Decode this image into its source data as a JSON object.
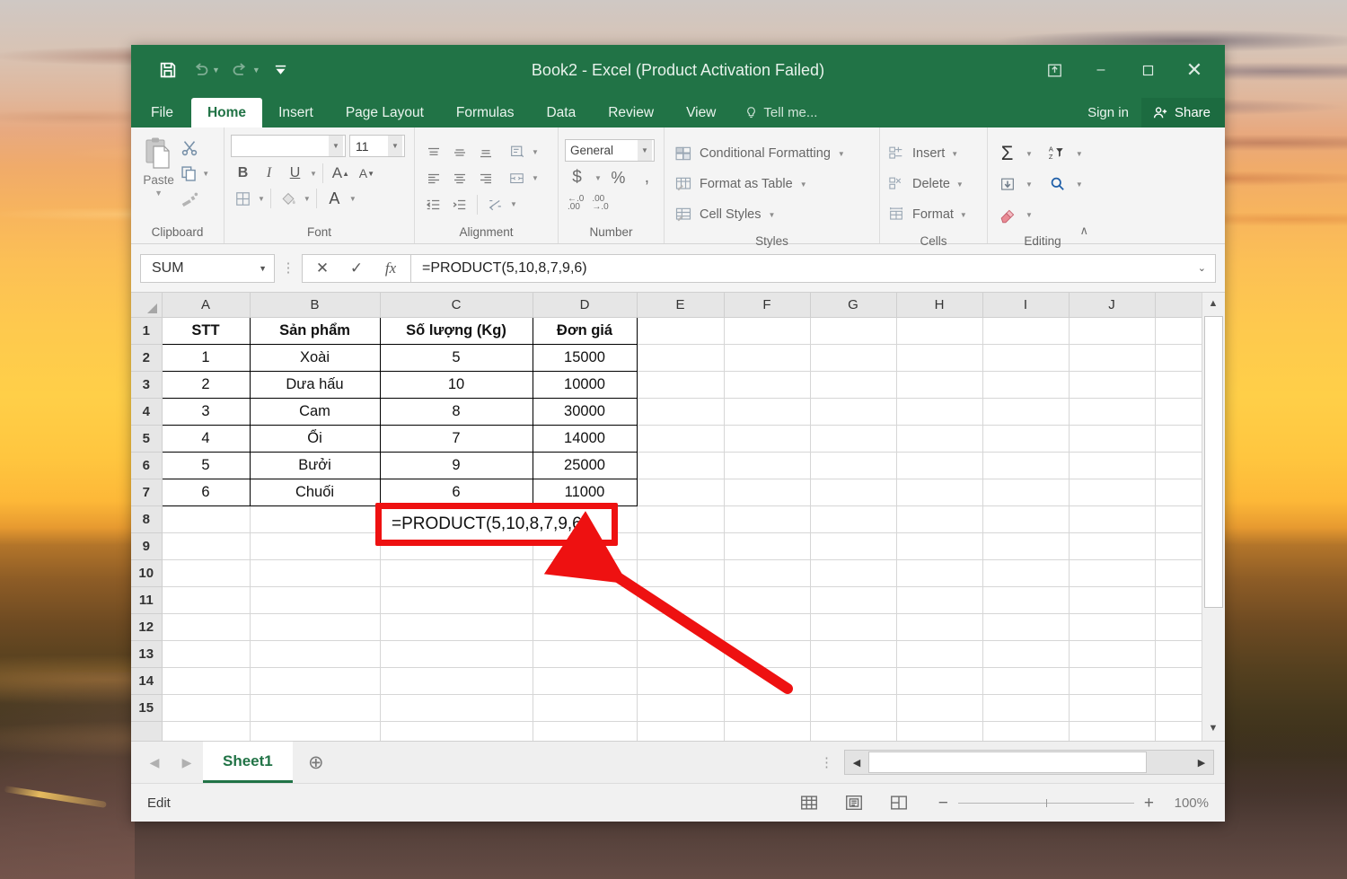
{
  "window": {
    "title": "Book2 - Excel (Product Activation Failed)",
    "quick_access": [
      "save-icon",
      "undo-icon",
      "redo-icon",
      "customize-qat-icon"
    ],
    "controls": {
      "ribbon_display": "ribbon-display-options-icon",
      "minimize": "–",
      "maximize": "❐",
      "close": "✕"
    }
  },
  "ribbon_tabs": {
    "items": [
      "File",
      "Home",
      "Insert",
      "Page Layout",
      "Formulas",
      "Data",
      "Review",
      "View"
    ],
    "active": "Home",
    "tell_me": "Tell me...",
    "sign_in": "Sign in",
    "share": "Share"
  },
  "ribbon": {
    "clipboard": {
      "label": "Clipboard",
      "paste": "Paste",
      "cut": "scissors-icon",
      "copy": "copy-icon",
      "format_painter": "format-painter-icon"
    },
    "font": {
      "label": "Font",
      "font_name_value": "",
      "font_name_placeholder": "",
      "font_size_value": "11",
      "bold": "B",
      "italic": "I",
      "underline": "U",
      "grow_font": "A",
      "shrink_font": "A",
      "borders": "borders-icon",
      "fill_color": "fill-color-icon",
      "font_color": "A"
    },
    "alignment": {
      "label": "Alignment",
      "buttons": [
        "align-top",
        "align-middle",
        "align-bottom",
        "orientation",
        "align-left",
        "align-center",
        "align-right",
        "merge-and-center",
        "decrease-indent",
        "increase-indent",
        "wrap-text"
      ]
    },
    "number": {
      "label": "Number",
      "format_value": "General",
      "buttons": [
        "accounting-format",
        "percent-style",
        "comma-style",
        "increase-decimal",
        "decrease-decimal"
      ]
    },
    "styles": {
      "label": "Styles",
      "items": [
        "Conditional Formatting",
        "Format as Table",
        "Cell Styles"
      ]
    },
    "cells": {
      "label": "Cells",
      "items": [
        "Insert",
        "Delete",
        "Format"
      ]
    },
    "editing": {
      "label": "Editing",
      "buttons": [
        "autosum-icon",
        "sort-and-filter-icon",
        "fill-icon",
        "find-and-select-icon",
        "clear-icon"
      ]
    }
  },
  "formula_bar": {
    "name_box": "SUM",
    "cancel": "✕",
    "enter": "✓",
    "insert_function": "fx",
    "formula": "=PRODUCT(5,10,8,7,9,6)"
  },
  "grid": {
    "columns": [
      "A",
      "B",
      "C",
      "D",
      "E",
      "F",
      "G",
      "H",
      "I",
      "J"
    ],
    "rows": [
      "1",
      "2",
      "3",
      "4",
      "5",
      "6",
      "7",
      "8",
      "9",
      "10",
      "11",
      "12",
      "13",
      "14",
      "15"
    ],
    "table": {
      "headers": [
        "STT",
        "Sản phẩm",
        "Số lượng (Kg)",
        "Đơn giá"
      ],
      "rows": [
        [
          "1",
          "Xoài",
          "5",
          "15000"
        ],
        [
          "2",
          "Dưa hấu",
          "10",
          "10000"
        ],
        [
          "3",
          "Cam",
          "8",
          "30000"
        ],
        [
          "4",
          "Ổi",
          "7",
          "14000"
        ],
        [
          "5",
          "Bưởi",
          "9",
          "25000"
        ],
        [
          "6",
          "Chuối",
          "6",
          "11000"
        ]
      ]
    },
    "editing_cell": {
      "reference": "C8",
      "text": "=PRODUCT(5,10,8,7,9,6)",
      "highlight_color": "#ee1111"
    },
    "annotation_arrow_color": "#ee1111"
  },
  "sheet_tabs": {
    "prev": "◀",
    "next": "▶",
    "tabs": [
      "Sheet1"
    ],
    "active": "Sheet1",
    "add": "⊕"
  },
  "status_bar": {
    "mode": "Edit",
    "views": [
      "normal-view-icon",
      "page-layout-view-icon",
      "page-break-preview-icon"
    ],
    "zoom_out": "−",
    "zoom_in": "+",
    "zoom_level": "100%"
  }
}
